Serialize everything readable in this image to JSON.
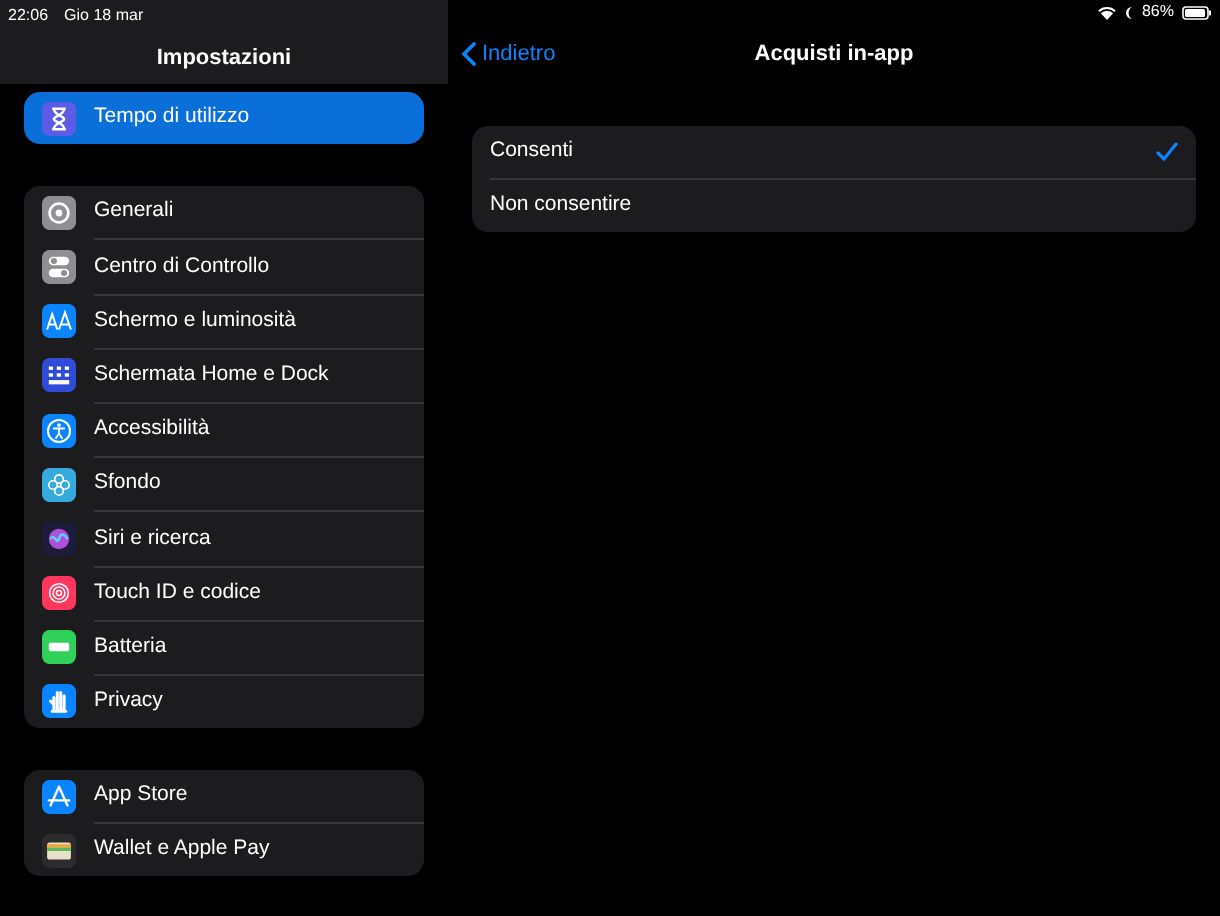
{
  "status_bar": {
    "time": "22:06",
    "date": "Gio 18 mar",
    "battery": "86%"
  },
  "sidebar": {
    "title": "Impostazioni",
    "groups": [
      [
        {
          "label": "Tempo di utilizzo",
          "kind": "hourglass",
          "selected": true
        }
      ],
      [
        {
          "label": "Generali",
          "kind": "gear",
          "selected": false
        },
        {
          "label": "Centro di Controllo",
          "kind": "toggles",
          "selected": false
        },
        {
          "label": "Schermo e luminosità",
          "kind": "text",
          "selected": false
        },
        {
          "label": "Schermata Home e Dock",
          "kind": "grid",
          "selected": false
        },
        {
          "label": "Accessibilità",
          "kind": "person",
          "selected": false
        },
        {
          "label": "Sfondo",
          "kind": "flower",
          "selected": false
        },
        {
          "label": "Siri e ricerca",
          "kind": "siri",
          "selected": false
        },
        {
          "label": "Touch ID e codice",
          "kind": "fingerprint",
          "selected": false
        },
        {
          "label": "Batteria",
          "kind": "battery",
          "selected": false
        },
        {
          "label": "Privacy",
          "kind": "hand",
          "selected": false
        }
      ],
      [
        {
          "label": "App Store",
          "kind": "appstore",
          "selected": false
        },
        {
          "label": "Wallet e Apple Pay",
          "kind": "wallet",
          "selected": false
        }
      ]
    ]
  },
  "detail": {
    "back": "Indietro",
    "title": "Acquisti in-app",
    "options": [
      {
        "label": "Consenti",
        "selected": true
      },
      {
        "label": "Non consentire",
        "selected": false
      }
    ]
  }
}
